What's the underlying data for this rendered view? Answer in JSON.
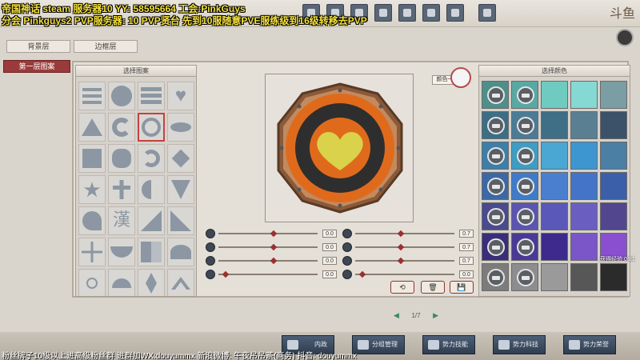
{
  "overlay": {
    "line1": "帝国神话 steam 服务器10   YY: 58595664   工会:PinkGuys",
    "line2": "分会 Pinkguys2  PVP服务器: 10 PVP贤台   先到10服随意PVE服练级到16级转移去PVP",
    "bottom": "粉丝牌子10级以上进高级粉丝群  进群加WX:douyummx 新浪微博: 午夜吊吊茶(商务)   抖音: douyummx"
  },
  "logo": "斗鱼",
  "tabs": {
    "background": "背景层",
    "border": "边框层",
    "first_layer": "第一层图案"
  },
  "panels": {
    "pattern_title": "选择图案",
    "color_title": "选择颜色",
    "color_one": "颜色一"
  },
  "sliders": [
    {
      "value": "0.0",
      "level": 0.55
    },
    {
      "value": "0.0",
      "level": 0.55
    },
    {
      "value": "0.0",
      "level": 0.55
    },
    {
      "value": "0.0",
      "level": 0.05
    },
    {
      "value": "0.7",
      "level": 0.45
    },
    {
      "value": "0.7",
      "level": 0.45
    },
    {
      "value": "0.7",
      "level": 0.45
    },
    {
      "value": "0.0",
      "level": 0.05
    }
  ],
  "pager": {
    "text": "1/7"
  },
  "side_label": "获得经验 0.81",
  "nav": [
    "内政",
    "分组管理",
    "势力技能",
    "势力科技",
    "势力荣誉"
  ],
  "colors": {
    "accent": "#9b3a3a",
    "emblem_orange": "#e06a1c",
    "emblem_dark": "#2e2e2e",
    "heart": "#d9d24a"
  },
  "palette": [
    [
      "#4f8f8a",
      "#5aa8a4",
      "#6fcac0",
      "#86d8d2",
      "#7a9ea3"
    ],
    [
      "#3c6f86",
      "#4b7c97",
      "#3f6f86",
      "#5a7f93",
      "#3c5268"
    ],
    [
      "#3d7fa8",
      "#3f9cc3",
      "#4aa6d3",
      "#3d96d0",
      "#4b7fa3"
    ],
    [
      "#3c69a6",
      "#3f7bc8",
      "#4a7fd0",
      "#4374c8",
      "#3b5fa8"
    ],
    [
      "#4a4a8f",
      "#5b55b0",
      "#5a58b8",
      "#6a5fc0",
      "#52468f"
    ],
    [
      "#3a2e7a",
      "#4a3a96",
      "#3e2a8c",
      "#7a56c8",
      "#8a4fd0"
    ],
    [
      "#7c7c7c",
      "#8d8d8d",
      "#9a9a9a",
      "#575757",
      "#2b2b2b"
    ]
  ]
}
